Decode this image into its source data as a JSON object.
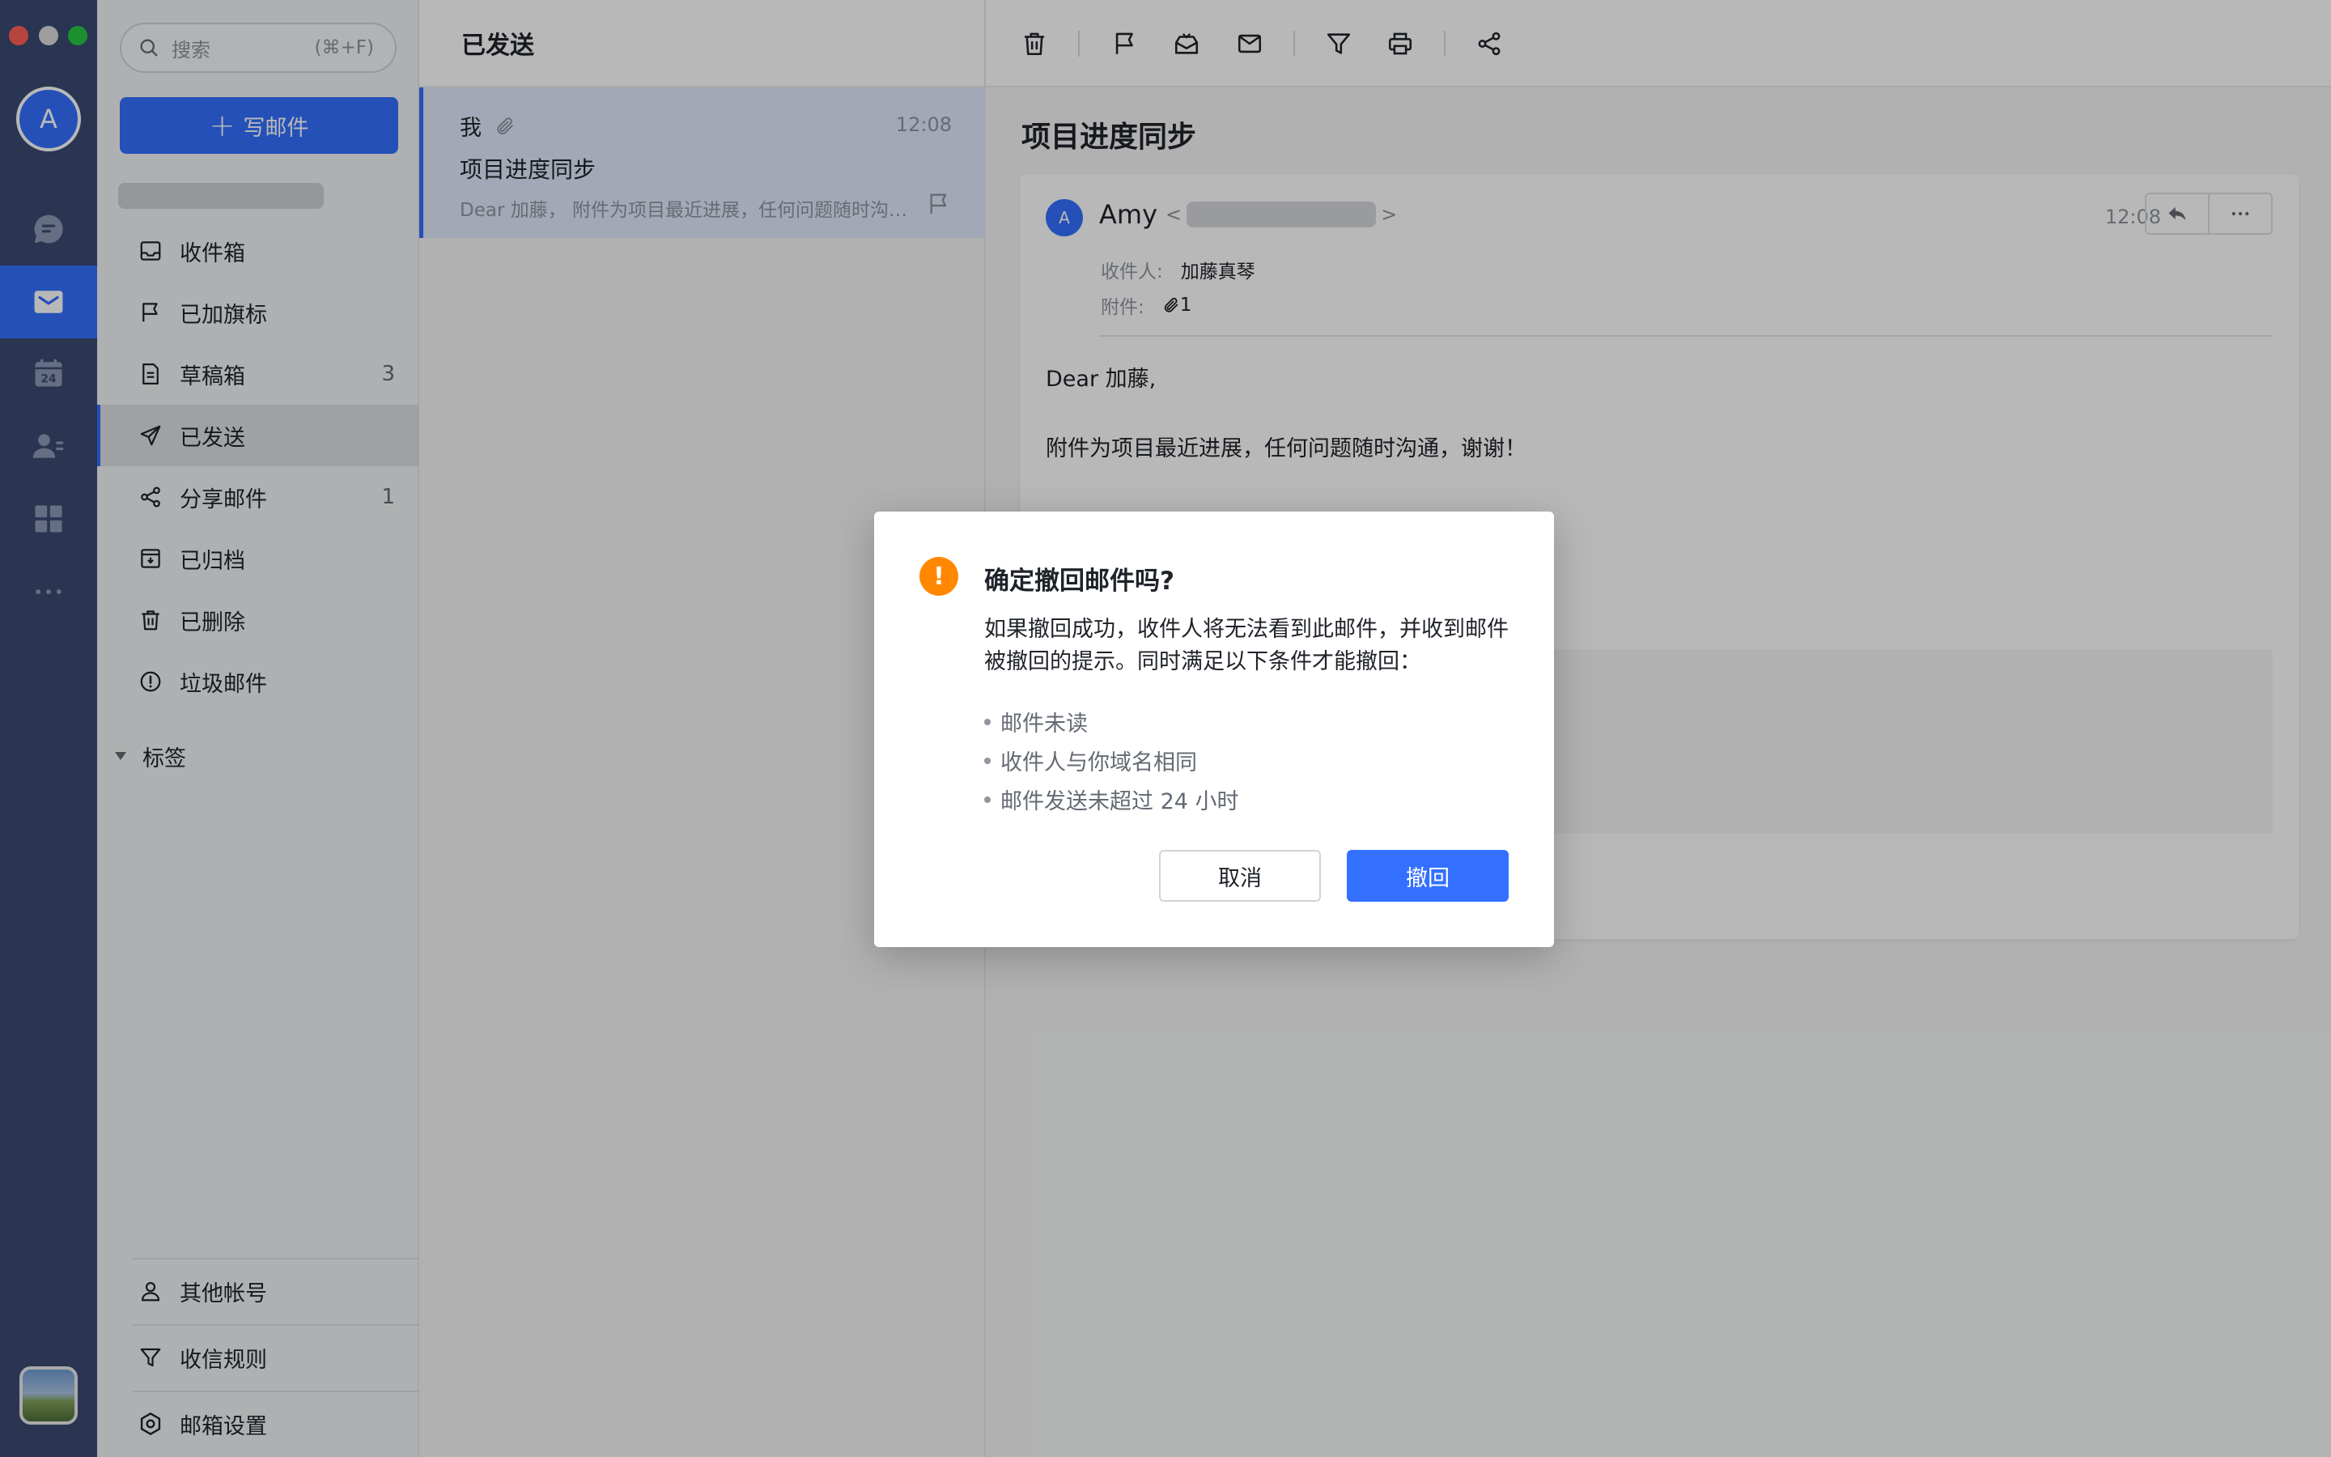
{
  "rail": {
    "avatar_letter": "A",
    "items": [
      {
        "name": "chat",
        "icon": "chat-bubble-icon"
      },
      {
        "name": "mail",
        "icon": "mail-icon",
        "active": true
      },
      {
        "name": "calendar",
        "icon": "calendar-icon",
        "badge": "24"
      },
      {
        "name": "contacts",
        "icon": "contacts-icon"
      },
      {
        "name": "workplace",
        "icon": "apps-grid-icon"
      },
      {
        "name": "more",
        "icon": "more-icon"
      }
    ]
  },
  "sidebar": {
    "search_placeholder": "搜索",
    "search_shortcut": "(⌘+F)",
    "compose_label": "写邮件",
    "folders": [
      {
        "label": "收件箱",
        "icon": "inbox-icon",
        "count": ""
      },
      {
        "label": "已加旗标",
        "icon": "flag-icon",
        "count": ""
      },
      {
        "label": "草稿箱",
        "icon": "draft-icon",
        "count": "3"
      },
      {
        "label": "已发送",
        "icon": "send-icon",
        "count": "",
        "active": true
      },
      {
        "label": "分享邮件",
        "icon": "share-icon",
        "count": "1"
      },
      {
        "label": "已归档",
        "icon": "archive-icon",
        "count": ""
      },
      {
        "label": "已删除",
        "icon": "trash-icon",
        "count": ""
      },
      {
        "label": "垃圾邮件",
        "icon": "spam-icon",
        "count": ""
      }
    ],
    "tags_label": "标签",
    "bottom": [
      {
        "label": "其他帐号",
        "icon": "person-icon"
      },
      {
        "label": "收信规则",
        "icon": "filter-icon"
      },
      {
        "label": "邮箱设置",
        "icon": "settings-icon"
      }
    ]
  },
  "list": {
    "header": "已发送",
    "message": {
      "from": "我",
      "time": "12:08",
      "subject": "项目进度同步",
      "preview": "Dear 加藤， 附件为项目最近进展，任何问题随时沟通，谢谢！"
    }
  },
  "reader": {
    "toolbar": [
      "trash-icon",
      "flag-icon",
      "mark-unread-icon",
      "envelope-icon",
      "filter-icon",
      "print-icon",
      "share-icon"
    ],
    "subject": "项目进度同步",
    "sender": {
      "avatar_letter": "A",
      "name": "Amy",
      "time": "12:08"
    },
    "to_label": "收件人:",
    "to_value": "加藤真琴",
    "attach_label": "附件:",
    "attach_count": "1",
    "body": [
      "Dear 加藤,",
      "附件为项目最近进展，任何问题随时沟通，谢谢！"
    ]
  },
  "dialog": {
    "title": "确定撤回邮件吗?",
    "description": "如果撤回成功，收件人将无法看到此邮件，并收到邮件被撤回的提示。同时满足以下条件才能撤回：",
    "conditions": [
      "邮件未读",
      "收件人与你域名相同",
      "邮件发送未超过 24 小时"
    ],
    "cancel_label": "取消",
    "confirm_label": "撤回",
    "icon": "warning-icon"
  },
  "colors": {
    "accent": "#3370ff",
    "rail_bg": "#3b4a72",
    "warning": "#ff8800"
  }
}
